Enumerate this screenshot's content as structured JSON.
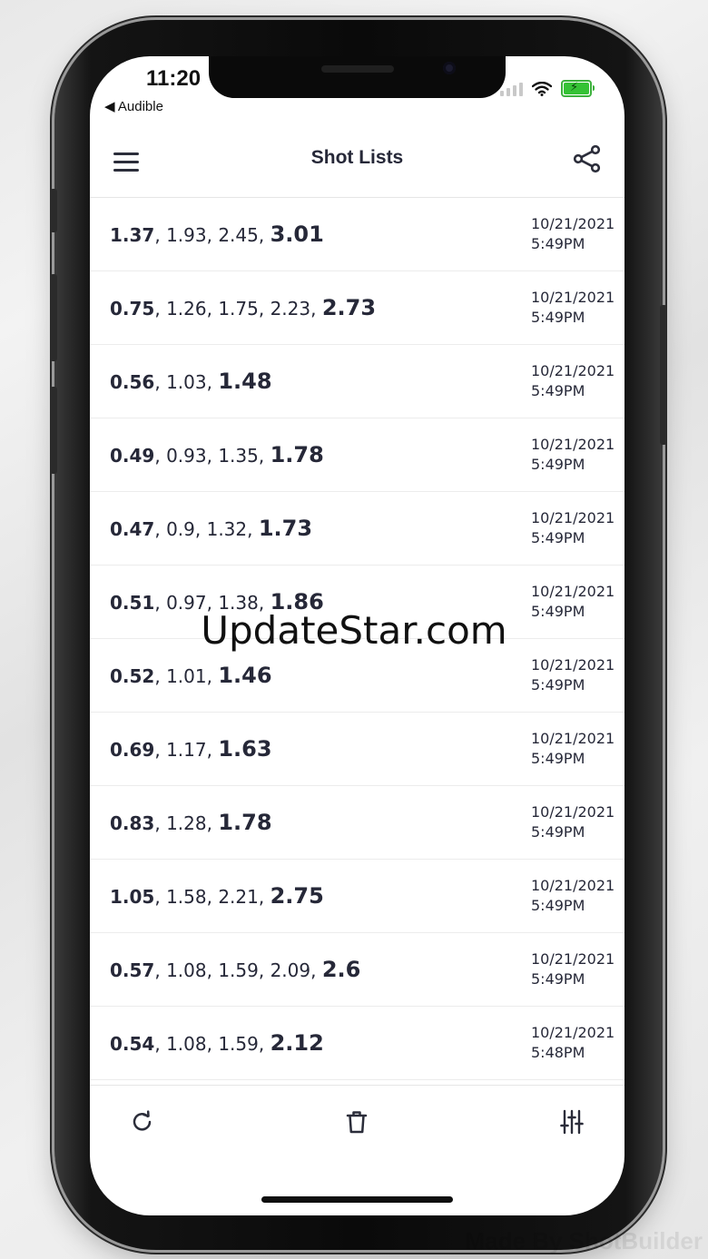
{
  "status": {
    "time": "11:20",
    "back_app": "◀ Audible"
  },
  "nav": {
    "title": "Shot Lists"
  },
  "rows": [
    {
      "first": "1.37",
      "mid": ", 1.93, 2.45, ",
      "last": "3.01",
      "date": "10/21/2021",
      "time": "5:49PM"
    },
    {
      "first": "0.75",
      "mid": ", 1.26, 1.75, 2.23, ",
      "last": "2.73",
      "date": "10/21/2021",
      "time": "5:49PM"
    },
    {
      "first": "0.56",
      "mid": ", 1.03, ",
      "last": "1.48",
      "date": "10/21/2021",
      "time": "5:49PM"
    },
    {
      "first": "0.49",
      "mid": ", 0.93, 1.35, ",
      "last": "1.78",
      "date": "10/21/2021",
      "time": "5:49PM"
    },
    {
      "first": "0.47",
      "mid": ", 0.9, 1.32, ",
      "last": "1.73",
      "date": "10/21/2021",
      "time": "5:49PM"
    },
    {
      "first": "0.51",
      "mid": ", 0.97, 1.38, ",
      "last": "1.86",
      "date": "10/21/2021",
      "time": "5:49PM"
    },
    {
      "first": "0.52",
      "mid": ", 1.01, ",
      "last": "1.46",
      "date": "10/21/2021",
      "time": "5:49PM"
    },
    {
      "first": "0.69",
      "mid": ", 1.17, ",
      "last": "1.63",
      "date": "10/21/2021",
      "time": "5:49PM"
    },
    {
      "first": "0.83",
      "mid": ", 1.28, ",
      "last": "1.78",
      "date": "10/21/2021",
      "time": "5:49PM"
    },
    {
      "first": "1.05",
      "mid": ", 1.58, 2.21, ",
      "last": "2.75",
      "date": "10/21/2021",
      "time": "5:49PM"
    },
    {
      "first": "0.57",
      "mid": ", 1.08, 1.59, 2.09, ",
      "last": "2.6",
      "date": "10/21/2021",
      "time": "5:49PM"
    },
    {
      "first": "0.54",
      "mid": ", 1.08, 1.59, ",
      "last": "2.12",
      "date": "10/21/2021",
      "time": "5:48PM"
    }
  ],
  "toolbar": {
    "icons": [
      "refresh-icon",
      "trash-icon",
      "sliders-icon"
    ]
  },
  "watermark": "UpdateStar.com",
  "madeby": "Made By ShotBuilder",
  "colors": {
    "text": "#262838",
    "battery": "#35c235"
  }
}
